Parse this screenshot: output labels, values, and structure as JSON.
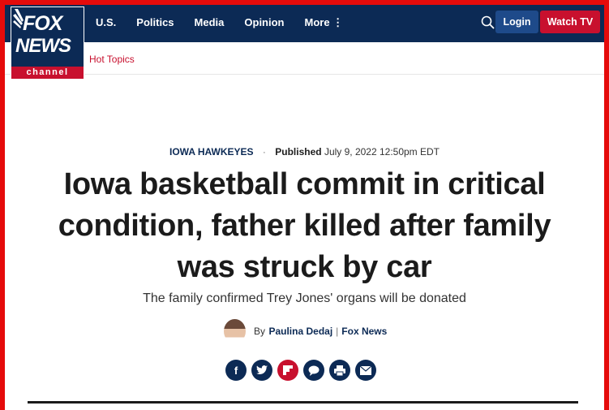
{
  "nav": {
    "logo": {
      "fox": "FOX",
      "news": "NEWS",
      "channel": "channel"
    },
    "links": [
      "U.S.",
      "Politics",
      "Media",
      "Opinion",
      "More ⋮"
    ],
    "login": "Login",
    "watch_tv": "Watch TV"
  },
  "subnav": {
    "hot_topics": "Hot Topics"
  },
  "article": {
    "category": "IOWA HAWKEYES",
    "separator": "·",
    "published_label": "Published",
    "published_date": "July 9, 2022 12:50pm EDT",
    "headline": "Iowa basketball commit in critical condition, father killed after family was struck by car",
    "subheadline": "The family confirmed Trey Jones' organs will be donated",
    "byline": {
      "by": "By",
      "author": "Paulina Dedaj",
      "sep": "|",
      "source": "Fox News"
    },
    "share": [
      "facebook-icon",
      "twitter-icon",
      "flipboard-icon",
      "comment-icon",
      "print-icon",
      "email-icon"
    ]
  },
  "colors": {
    "brand_blue": "#0c2a55",
    "brand_red": "#c8102e",
    "frame_red": "#e50b0b"
  }
}
